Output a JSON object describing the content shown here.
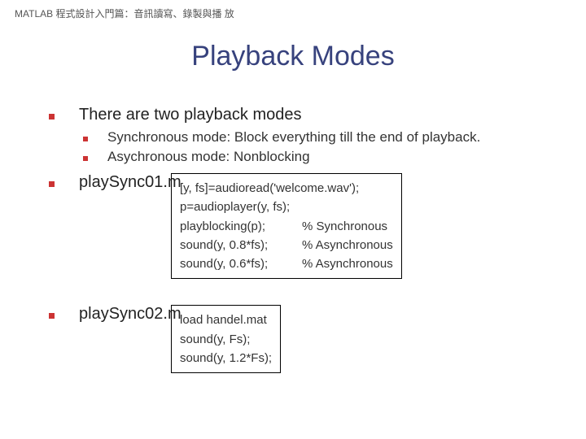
{
  "header": "MATLAB 程式設計入門篇：音訊讀寫、錄製與播 放",
  "title": "Playback Modes",
  "bullets": {
    "intro": "There are two playback modes",
    "sync": "Synchronous mode: Block everything till the end of playback.",
    "async": "Asychronous mode: Nonblocking",
    "file1": "playSync01.m",
    "file2": "playSync02.m"
  },
  "code1": {
    "l0": "[y, fs]=audioread('welcome.wav');",
    "l1": "p=audioplayer(y, fs);",
    "l2a": "playblocking(p);",
    "l2b": "% Synchronous",
    "l3a": "sound(y, 0.8*fs);",
    "l3b": "% Asynchronous",
    "l4a": "sound(y, 0.6*fs);",
    "l4b": "% Asynchronous"
  },
  "code2": {
    "l0": "load handel.mat",
    "l1": "sound(y, Fs);",
    "l2": "sound(y, 1.2*Fs);"
  }
}
